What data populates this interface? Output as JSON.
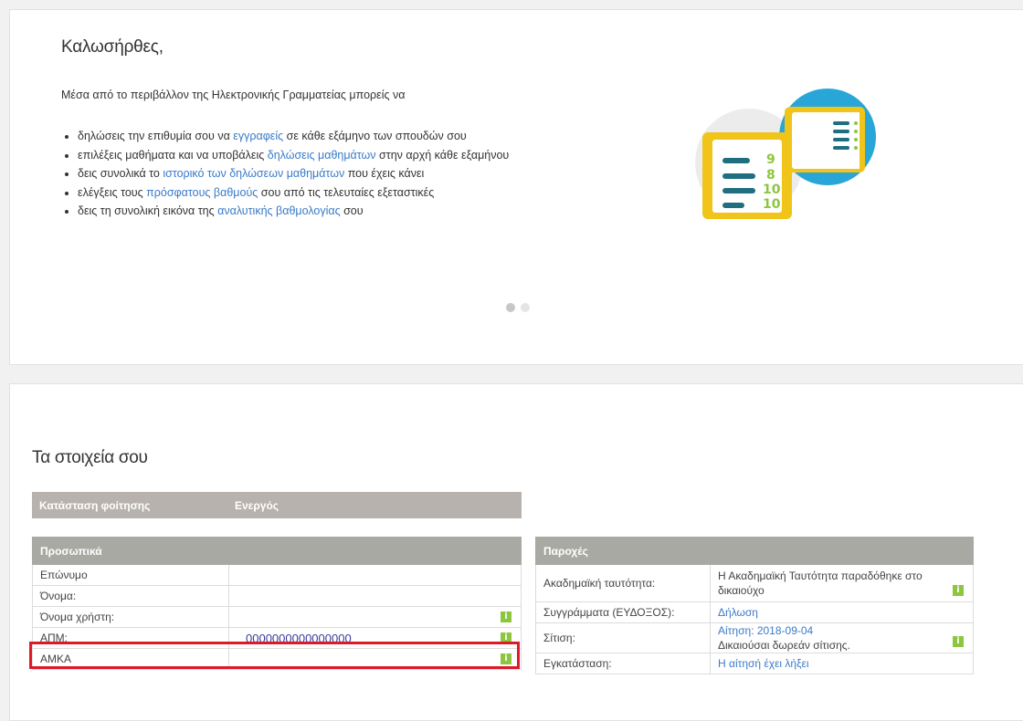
{
  "welcome": {
    "title": "Καλωσήρθες,",
    "intro": "Μέσα από το περιβάλλον της Ηλεκτρονικής Γραμματείας μπορείς να",
    "items": [
      {
        "pre": "δηλώσεις την επιθυμία σου να ",
        "link": "εγγραφείς",
        "post": " σε κάθε εξάμηνο των σπουδών σου"
      },
      {
        "pre": "επιλέξεις μαθήματα και να υποβάλεις ",
        "link": "δηλώσεις μαθημάτων",
        "post": " στην αρχή κάθε εξαμήνου"
      },
      {
        "pre": "δεις συνολικά το ",
        "link": "ιστορικό των δηλώσεων μαθημάτων",
        "post": " που έχεις κάνει"
      },
      {
        "pre": "ελέγξεις τους ",
        "link": "πρόσφατους βαθμούς",
        "post": " σου από τις τελευταίες εξεταστικές"
      },
      {
        "pre": "δεις τη συνολική εικόνα της ",
        "link": "αναλυτικής βαθμολογίας",
        "post": " σου"
      }
    ],
    "illustration": {
      "grades": [
        "9",
        "8",
        "10",
        "10"
      ]
    }
  },
  "student": {
    "title": "Τα στοιχεία σου",
    "status_label": "Κατάσταση φοίτησης",
    "status_value": "Ενεργός",
    "personal": {
      "header": "Προσωπικά",
      "rows": [
        {
          "label": "Επώνυμο",
          "value": ""
        },
        {
          "label": "Όνομα:",
          "value": ""
        },
        {
          "label": "Όνομα χρήστη:",
          "value": ""
        },
        {
          "label": "ΑΠΜ:",
          "value": "0000000000000000"
        },
        {
          "label": "ΑΜΚΑ",
          "value": ""
        }
      ]
    },
    "benefits": {
      "header": "Παροχές",
      "rows": [
        {
          "label": "Ακαδημαϊκή ταυτότητα:",
          "value": "Η Ακαδημαϊκή Ταυτότητα παραδόθηκε στο δικαιούχο"
        },
        {
          "label": "Συγγράμματα (ΕΥΔΟΞΟΣ):",
          "link": "Δήλωση"
        },
        {
          "label": "Σίτιση:",
          "link": "Αίτηση: 2018-09-04",
          "note": "Δικαιούσαι δωρεάν σίτισης."
        },
        {
          "label": "Εγκατάσταση:",
          "link": "Η αίτησή έχει λήξει"
        }
      ]
    }
  },
  "icons": {
    "info": "i"
  },
  "colors": {
    "link": "#3a7bc8",
    "info": "#8dc63f",
    "highlight": "#e0192a",
    "header": "#a9a9a4"
  }
}
